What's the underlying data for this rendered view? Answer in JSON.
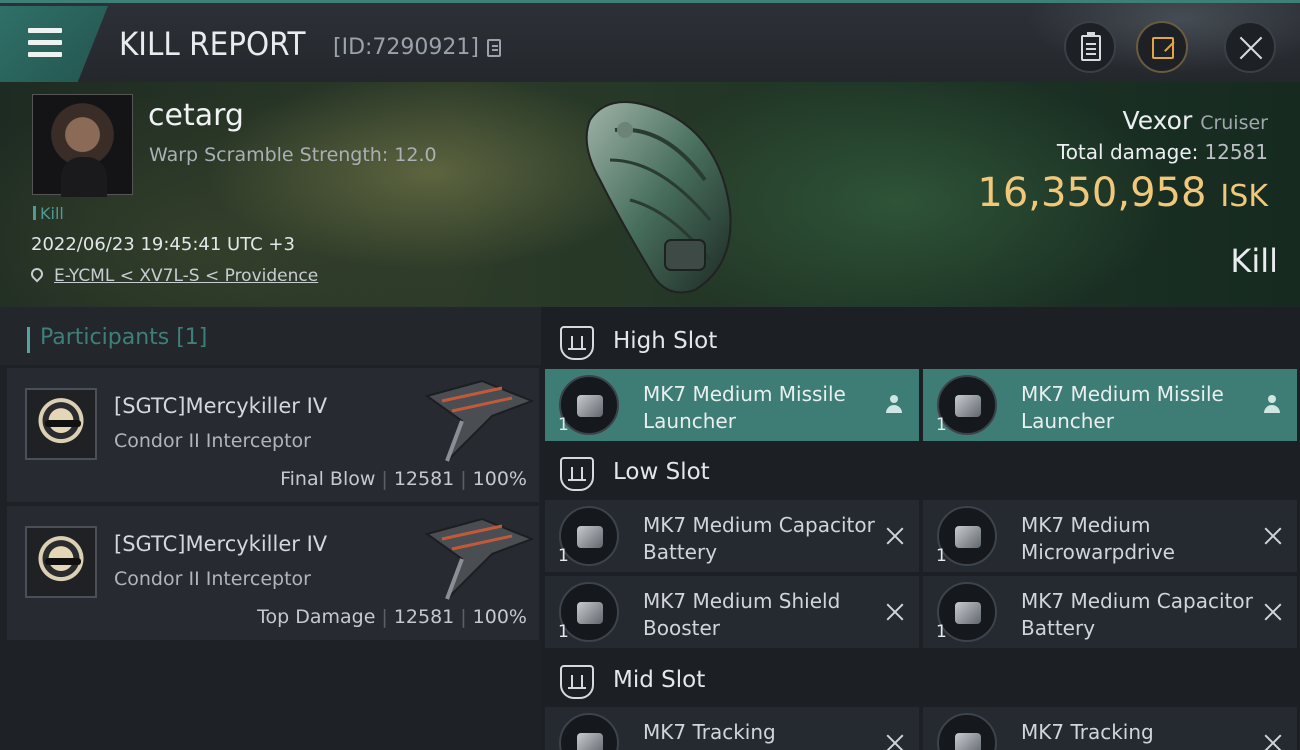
{
  "header": {
    "title": "KILL REPORT",
    "report_id": "[ID:7290921]"
  },
  "victim": {
    "name": "cetarg",
    "warp_scramble": "Warp Scramble Strength: 12.0",
    "kill_tag": "Kill",
    "datetime": "2022/06/23 19:45:41 UTC +3",
    "location": "E-YCML < XV7L-S < Providence",
    "ship_name": "Vexor",
    "ship_class": "Cruiser",
    "total_damage_label": "Total damage:",
    "total_damage_value": "12581",
    "isk_value": "16,350,958",
    "isk_unit": "ISK",
    "result": "Kill"
  },
  "participants": {
    "title": "Participants [1]",
    "items": [
      {
        "name": "[SGTC]Mercykiller IV",
        "ship": "Condor II Interceptor",
        "role": "Final Blow",
        "damage": "12581",
        "percent": "100%"
      },
      {
        "name": "[SGTC]Mercykiller IV",
        "ship": "Condor II Interceptor",
        "role": "Top Damage",
        "damage": "12581",
        "percent": "100%"
      }
    ]
  },
  "slots": {
    "high": {
      "title": "High Slot",
      "modules": [
        {
          "qty": "1",
          "name": "MK7 Medium Missile Launcher"
        },
        {
          "qty": "1",
          "name": "MK7 Medium Missile Launcher"
        }
      ]
    },
    "low": {
      "title": "Low Slot",
      "modules": [
        {
          "qty": "1",
          "name": "MK7 Medium Capacitor Battery"
        },
        {
          "qty": "1",
          "name": "MK7 Medium Microwarpdrive"
        },
        {
          "qty": "1",
          "name": "MK7 Medium Shield Booster"
        },
        {
          "qty": "1",
          "name": "MK7 Medium Capacitor Battery"
        }
      ]
    },
    "mid": {
      "title": "Mid Slot",
      "modules": [
        {
          "qty": "1",
          "name": "MK7 Tracking"
        },
        {
          "qty": "1",
          "name": "MK7 Tracking"
        }
      ]
    }
  },
  "colors": {
    "accent_teal": "#3e7d76",
    "isk_gold": "#f1c77a",
    "share_orange": "#e0a646"
  }
}
